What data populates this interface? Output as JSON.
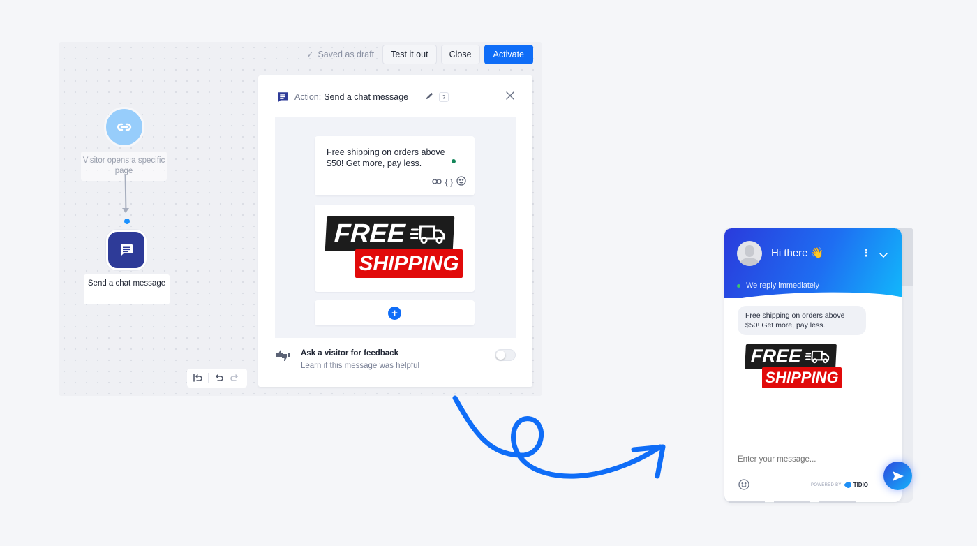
{
  "editor": {
    "topbar": {
      "saved_status": "Saved as draft",
      "test_label": "Test it out",
      "close_label": "Close",
      "activate_label": "Activate",
      "accent_color": "#0f6df7"
    },
    "nodes": {
      "trigger": {
        "label": "Visitor opens a specific page",
        "icon": "link-icon"
      },
      "action": {
        "label": "Send a chat message",
        "icon": "chat-message-icon"
      }
    },
    "history": {
      "icons": [
        "reset-icon",
        "undo-icon",
        "redo-icon"
      ]
    }
  },
  "panel": {
    "prefix": "Action:",
    "name": "Send a chat message",
    "help": "?",
    "message_text": "Free shipping on orders above $50! Get more, pay less.",
    "message_tools": [
      "link-icon",
      "variable-icon",
      "emoji-icon"
    ],
    "image": {
      "line1": "FREE",
      "line2": "SHIPPING"
    },
    "add_block": "+",
    "feedback": {
      "title": "Ask a visitor for feedback",
      "subtitle": "Learn if this message was helpful",
      "enabled": false
    }
  },
  "widget": {
    "title": "Hi there",
    "title_emoji": "👋",
    "status": "We reply immediately",
    "bubble_text": "Free shipping on orders above $50! Get more, pay less.",
    "image": {
      "line1": "FREE",
      "line2": "SHIPPING"
    },
    "input_placeholder": "Enter your message...",
    "powered_by": "POWERED BY",
    "brand": "TIDIO",
    "colors": {
      "header_start": "#2a3bdc",
      "header_end": "#12b7fb",
      "online": "#3ec46d"
    }
  }
}
